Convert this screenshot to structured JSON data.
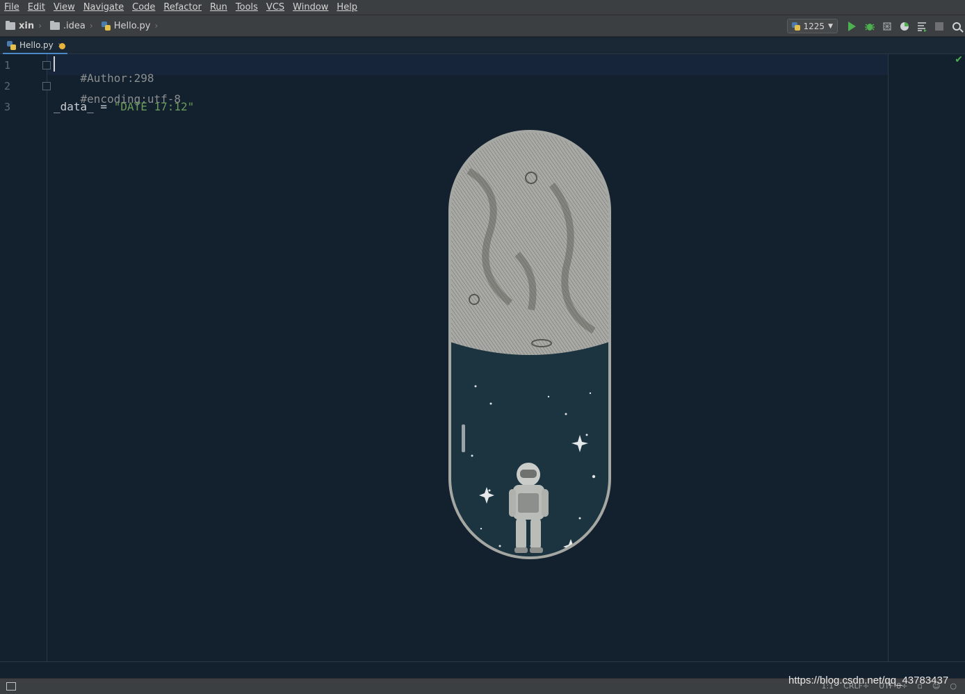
{
  "menu": {
    "items": [
      "File",
      "Edit",
      "View",
      "Navigate",
      "Code",
      "Refactor",
      "Run",
      "Tools",
      "VCS",
      "Window",
      "Help"
    ]
  },
  "breadcrumb": {
    "items": [
      "xin",
      ".idea",
      "Hello.py"
    ]
  },
  "toolbar": {
    "run_config": "1225",
    "icons": [
      "run-icon",
      "debug-icon",
      "coverage-icon",
      "profile-icon",
      "concurrency-icon",
      "stop-icon",
      "search-icon"
    ]
  },
  "tab": {
    "label": "Hello.py",
    "close": "×"
  },
  "editor": {
    "line_numbers": [
      "1",
      "2",
      "3"
    ],
    "lines": [
      {
        "comment": "#Author:298"
      },
      {
        "comment": "#encoding:utf-8"
      },
      {
        "plain": "_data_ = ",
        "string": "\"DATE 17:12\""
      }
    ]
  },
  "statusbar": {
    "position": "1:1",
    "line_sep": "CRLF÷",
    "encoding": "UTF-8÷"
  },
  "watermark": "https://blog.csdn.net/qq_43783437",
  "colors": {
    "background": "#13202e",
    "comment": "#8b8e90",
    "string": "#6a9a5c",
    "run_green": "#4caf50",
    "accent": "#4a88c7"
  }
}
